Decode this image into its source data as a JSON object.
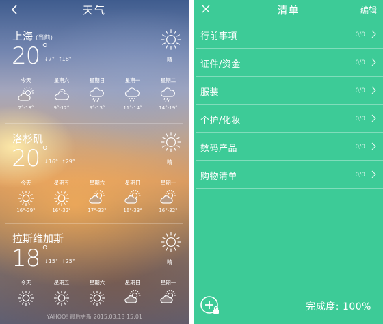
{
  "colors": {
    "checklist_green": "#3dcb97"
  },
  "weather": {
    "title": "天气",
    "cities": [
      {
        "name": "上海",
        "tag": "(当前)",
        "temp": "20",
        "deg": "°",
        "low": "7°",
        "high": "18°",
        "condition_icon": "sun-icon",
        "condition": "晴",
        "forecast": [
          {
            "day": "今天",
            "icon": "cloudy-sun-icon",
            "range": "7°-18°"
          },
          {
            "day": "星期六",
            "icon": "cloud-icon",
            "range": "9°-12°"
          },
          {
            "day": "星期日",
            "icon": "rain-icon",
            "range": "9°-13°"
          },
          {
            "day": "星期一",
            "icon": "snow-icon",
            "range": "11°-14°"
          },
          {
            "day": "星期二",
            "icon": "rain-icon",
            "range": "14°-19°"
          }
        ]
      },
      {
        "name": "洛杉矶",
        "tag": "",
        "temp": "20",
        "deg": "°",
        "low": "16°",
        "high": "29°",
        "condition_icon": "sun-icon",
        "condition": "晴",
        "forecast": [
          {
            "day": "今天",
            "icon": "sun-icon",
            "range": "16°-29°"
          },
          {
            "day": "星期五",
            "icon": "sun-icon",
            "range": "16°-32°"
          },
          {
            "day": "星期六",
            "icon": "cloudy-sun-icon",
            "range": "17°-33°"
          },
          {
            "day": "星期日",
            "icon": "cloudy-sun-icon",
            "range": "16°-33°"
          },
          {
            "day": "星期一",
            "icon": "cloudy-sun-icon",
            "range": "16°-32°"
          }
        ]
      },
      {
        "name": "拉斯维加斯",
        "tag": "",
        "temp": "18",
        "deg": "°",
        "low": "15°",
        "high": "25°",
        "condition_icon": "sun-icon",
        "condition": "晴",
        "forecast": [
          {
            "day": "今天",
            "icon": "sun-icon",
            "range": ""
          },
          {
            "day": "星期五",
            "icon": "sun-icon",
            "range": ""
          },
          {
            "day": "星期六",
            "icon": "sun-icon",
            "range": ""
          },
          {
            "day": "星期日",
            "icon": "cloudy-sun-icon",
            "range": ""
          },
          {
            "day": "星期一",
            "icon": "cloudy-sun-icon",
            "range": ""
          }
        ]
      }
    ],
    "footer": "YAHOO!  最后更新  2015.03.13 15:01"
  },
  "checklist": {
    "title": "清单",
    "edit_label": "编辑",
    "items": [
      {
        "label": "行前事项",
        "count": "0/0"
      },
      {
        "label": "证件/资金",
        "count": "0/0"
      },
      {
        "label": "服装",
        "count": "0/0"
      },
      {
        "label": "个护/化妆",
        "count": "0/0"
      },
      {
        "label": "数码产品",
        "count": "0/0"
      },
      {
        "label": "购物清单",
        "count": "0/0"
      }
    ],
    "progress_label": "完成度: 100%"
  }
}
